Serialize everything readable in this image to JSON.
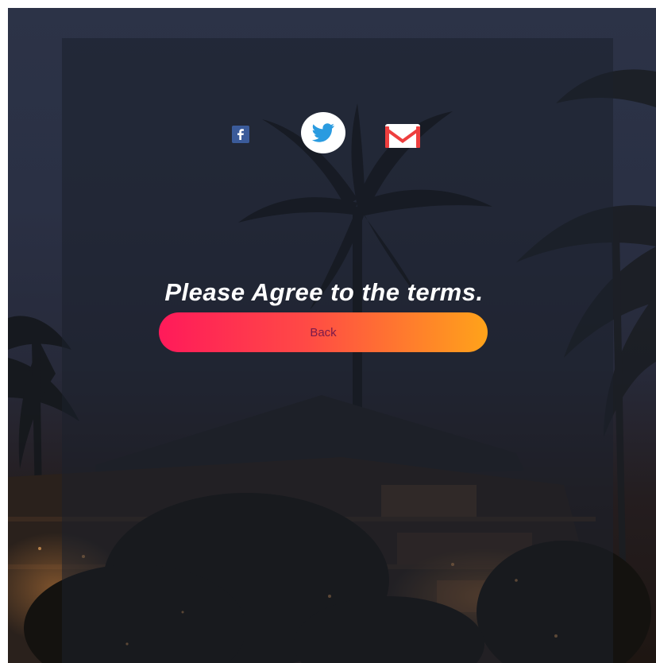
{
  "social": {
    "facebook": {
      "icon": "facebook-icon",
      "color": "#3b5b9a"
    },
    "twitter": {
      "icon": "twitter-icon",
      "color": "#2a9be0"
    },
    "email": {
      "icon": "mail-icon",
      "color": "#ee3e3e"
    }
  },
  "message": {
    "text": "Please Agree to the terms."
  },
  "back_button": {
    "label": "Back",
    "gradient_start": "#ff1a5a",
    "gradient_end": "#ffa31a"
  }
}
